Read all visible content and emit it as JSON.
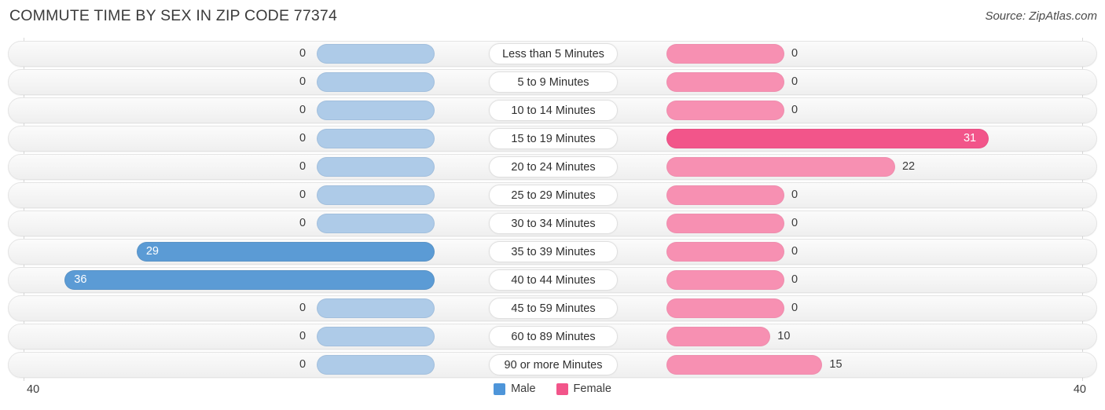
{
  "header": {
    "title": "COMMUTE TIME BY SEX IN ZIP CODE 77374",
    "source": "Source: ZipAtlas.com"
  },
  "legend": {
    "male_label": "Male",
    "female_label": "Female",
    "male_color": "#4e95d9",
    "female_color": "#f2558a"
  },
  "axis": {
    "left_max_label": "40",
    "right_max_label": "40"
  },
  "chart_data": {
    "type": "bar",
    "orientation": "horizontal-diverging",
    "title": "COMMUTE TIME BY SEX IN ZIP CODE 77374",
    "xlabel": "",
    "ylabel": "",
    "xlim": [
      40,
      40
    ],
    "grid": true,
    "legend_position": "bottom-center",
    "categories": [
      "Less than 5 Minutes",
      "5 to 9 Minutes",
      "10 to 14 Minutes",
      "15 to 19 Minutes",
      "20 to 24 Minutes",
      "25 to 29 Minutes",
      "30 to 34 Minutes",
      "35 to 39 Minutes",
      "40 to 44 Minutes",
      "45 to 59 Minutes",
      "60 to 89 Minutes",
      "90 or more Minutes"
    ],
    "series": [
      {
        "name": "Male",
        "color": "#4e95d9",
        "values": [
          0,
          0,
          0,
          0,
          0,
          0,
          0,
          29,
          36,
          0,
          0,
          0
        ]
      },
      {
        "name": "Female",
        "color": "#f2558a",
        "values": [
          0,
          0,
          0,
          31,
          22,
          0,
          0,
          0,
          0,
          0,
          10,
          15
        ]
      }
    ]
  },
  "rows": [
    {
      "category": "Less than 5 Minutes",
      "male": "0",
      "female": "0"
    },
    {
      "category": "5 to 9 Minutes",
      "male": "0",
      "female": "0"
    },
    {
      "category": "10 to 14 Minutes",
      "male": "0",
      "female": "0"
    },
    {
      "category": "15 to 19 Minutes",
      "male": "0",
      "female": "31"
    },
    {
      "category": "20 to 24 Minutes",
      "male": "0",
      "female": "22"
    },
    {
      "category": "25 to 29 Minutes",
      "male": "0",
      "female": "0"
    },
    {
      "category": "30 to 34 Minutes",
      "male": "0",
      "female": "0"
    },
    {
      "category": "35 to 39 Minutes",
      "male": "29",
      "female": "0"
    },
    {
      "category": "40 to 44 Minutes",
      "male": "36",
      "female": "0"
    },
    {
      "category": "45 to 59 Minutes",
      "male": "0",
      "female": "0"
    },
    {
      "category": "60 to 89 Minutes",
      "male": "0",
      "female": "10"
    },
    {
      "category": "90 or more Minutes",
      "male": "0",
      "female": "15"
    }
  ]
}
